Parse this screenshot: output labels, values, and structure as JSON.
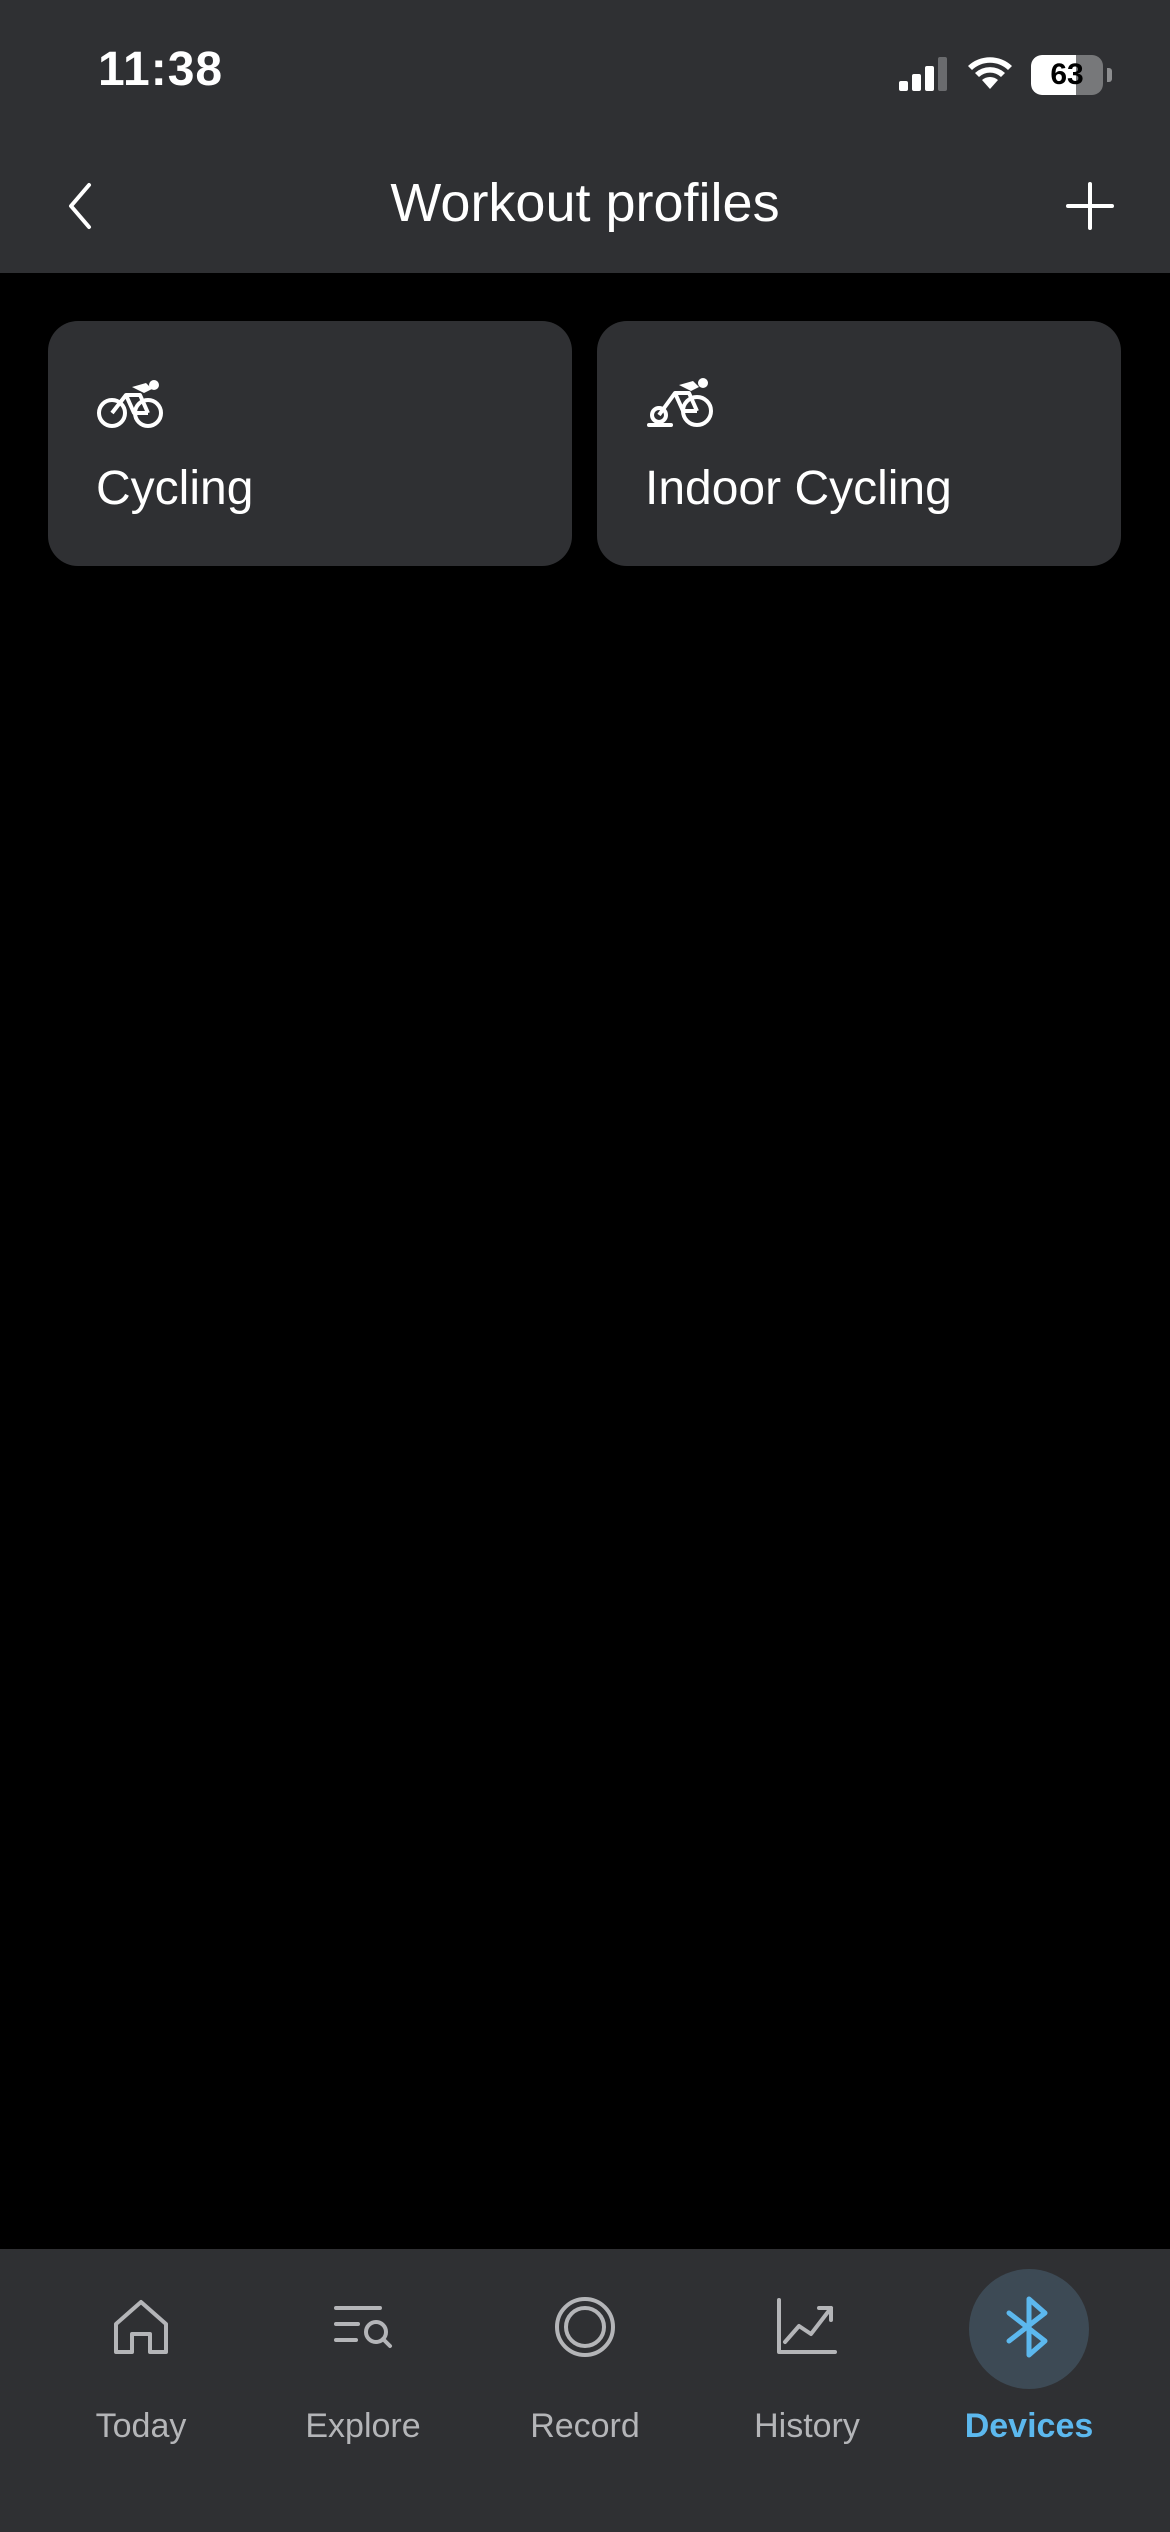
{
  "status_bar": {
    "time": "11:38",
    "battery_level": "63",
    "battery_fraction": 0.63
  },
  "header": {
    "title": "Workout profiles"
  },
  "profiles": [
    {
      "label": "Cycling",
      "icon": "bicycle-icon"
    },
    {
      "label": "Indoor Cycling",
      "icon": "indoor-bike-icon"
    }
  ],
  "tab_bar": {
    "items": [
      {
        "label": "Today",
        "icon": "home-icon",
        "active": false
      },
      {
        "label": "Explore",
        "icon": "explore-search-icon",
        "active": false
      },
      {
        "label": "Record",
        "icon": "record-icon",
        "active": false
      },
      {
        "label": "History",
        "icon": "chart-line-icon",
        "active": false
      },
      {
        "label": "Devices",
        "icon": "bluetooth-icon",
        "active": true
      }
    ]
  },
  "colors": {
    "background": "#000000",
    "surface": "#2f3033",
    "accent": "#5cb8ee",
    "inactive": "#b4b5b8",
    "active_pill": "#3d4a55"
  }
}
